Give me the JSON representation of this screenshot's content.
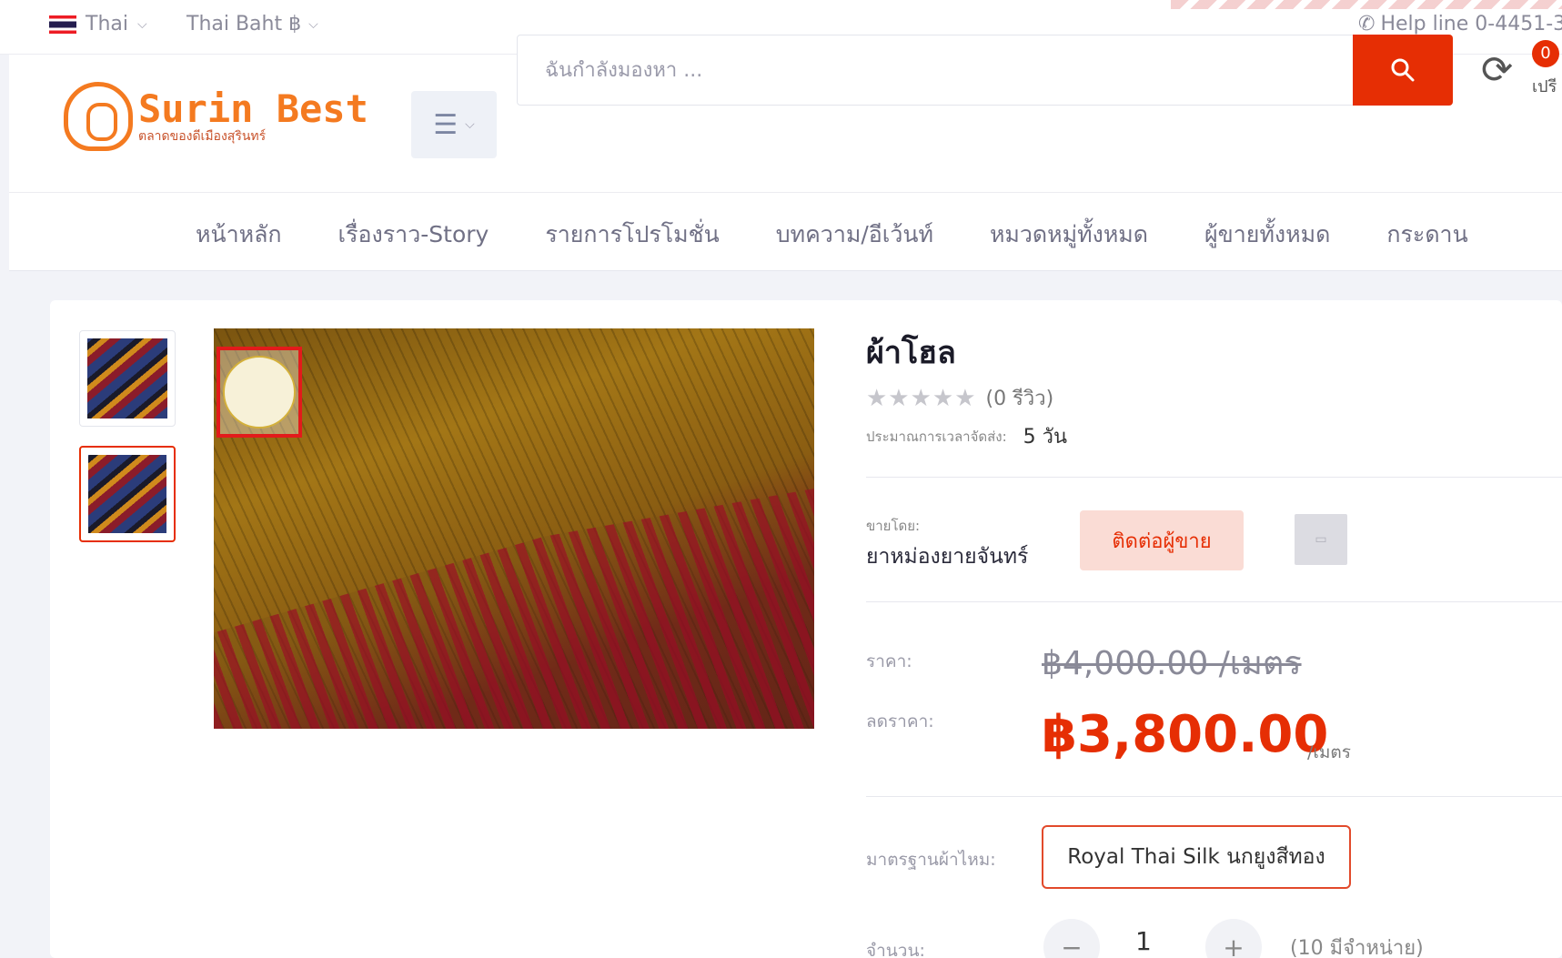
{
  "topbar": {
    "language": "Thai",
    "currency": "Thai Baht ฿",
    "helpline": "Help line 0-4451-3"
  },
  "header": {
    "logo_brand": "Surin Best",
    "logo_tagline": "ตลาดของดีเมืองสุรินทร์",
    "search_placeholder": "ฉันกำลังมองหา ...",
    "compare_count": "0",
    "compare_label": "เปรี"
  },
  "nav": {
    "items": [
      "หน้าหลัก",
      "เรื่องราว-Story",
      "รายการโปรโมชั่น",
      "บทความ/อีเว้นท์",
      "หมวดหมู่ทั้งหมด",
      "ผู้ขายทั้งหมด",
      "กระดาน"
    ]
  },
  "product": {
    "title": "ผ้าโฮล",
    "stars": "★★★★★",
    "reviews": "(0 รีวิว)",
    "delivery_label": "ประมาณการเวลาจัดส่ง:",
    "delivery_value": "5 วัน",
    "sold_by_label": "ขายโดย:",
    "seller_name": "ยาหม่องยายจันทร์",
    "contact_button": "ติดต่อผู้ขาย",
    "price_label": "ราคา:",
    "old_price": "฿4,000.00 /เมตร",
    "discount_label": "ลดราคา:",
    "new_price": "฿3,800.00",
    "new_price_unit": "/เมตร",
    "standard_label": "มาตรฐานผ้าไหม:",
    "standard_value": "Royal Thai Silk นกยูงสีทอง",
    "quantity_label": "จำนวน:",
    "quantity": "1",
    "minus": "−",
    "plus": "+",
    "available": "(10 มีจำหน่าย)"
  },
  "colors": {
    "accent": "#e62e04",
    "brand_orange": "#f47a20"
  },
  "icons": [
    "flag-thailand-icon",
    "chevron-down-icon",
    "phone-icon",
    "menu-icon",
    "search-icon",
    "compare-icon",
    "image-placeholder-icon"
  ]
}
